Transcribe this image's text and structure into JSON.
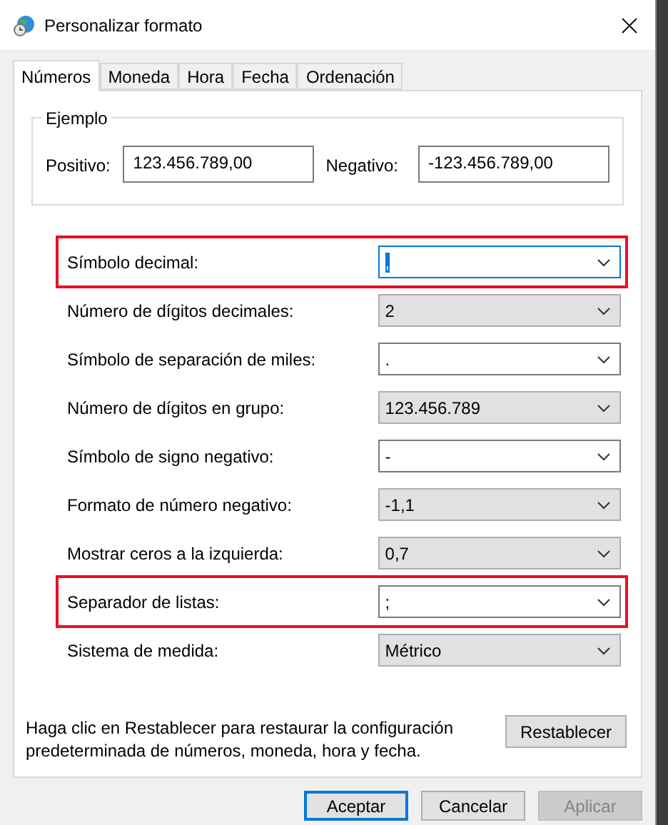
{
  "window": {
    "title": "Personalizar formato"
  },
  "tabs": [
    {
      "label": "Números",
      "selected": true
    },
    {
      "label": "Moneda",
      "selected": false
    },
    {
      "label": "Hora",
      "selected": false
    },
    {
      "label": "Fecha",
      "selected": false
    },
    {
      "label": "Ordenación",
      "selected": false
    }
  ],
  "example": {
    "title": "Ejemplo",
    "positive_label": "Positivo:",
    "positive_value": "123.456.789,00",
    "negative_label": "Negativo:",
    "negative_value": "-123.456.789,00"
  },
  "settings": [
    {
      "label": "Símbolo decimal:",
      "value": ",",
      "kind": "editable",
      "focused": true,
      "highlighted": true
    },
    {
      "label": "Número de dígitos decimales:",
      "value": "2",
      "kind": "dropdown",
      "focused": false,
      "highlighted": false
    },
    {
      "label": "Símbolo de separación de miles:",
      "value": ".",
      "kind": "editable",
      "focused": false,
      "highlighted": false
    },
    {
      "label": "Número de dígitos en grupo:",
      "value": "123.456.789",
      "kind": "dropdown",
      "focused": false,
      "highlighted": false
    },
    {
      "label": "Símbolo de signo negativo:",
      "value": "-",
      "kind": "editable",
      "focused": false,
      "highlighted": false
    },
    {
      "label": "Formato de número negativo:",
      "value": "-1,1",
      "kind": "dropdown",
      "focused": false,
      "highlighted": false
    },
    {
      "label": "Mostrar ceros a la izquierda:",
      "value": "0,7",
      "kind": "dropdown",
      "focused": false,
      "highlighted": false
    },
    {
      "label": "Separador de listas:",
      "value": ";",
      "kind": "editable",
      "focused": false,
      "highlighted": true
    },
    {
      "label": "Sistema de medida:",
      "value": "Métrico",
      "kind": "dropdown",
      "focused": false,
      "highlighted": false
    }
  ],
  "reset": {
    "text": "Haga clic en Restablecer para restaurar la configuración predeterminada de números, moneda, hora y fecha.",
    "button": "Restablecer"
  },
  "buttons": [
    {
      "label": "Aceptar",
      "default": true,
      "disabled": false
    },
    {
      "label": "Cancelar",
      "default": false,
      "disabled": false
    },
    {
      "label": "Aplicar",
      "default": false,
      "disabled": true
    }
  ]
}
